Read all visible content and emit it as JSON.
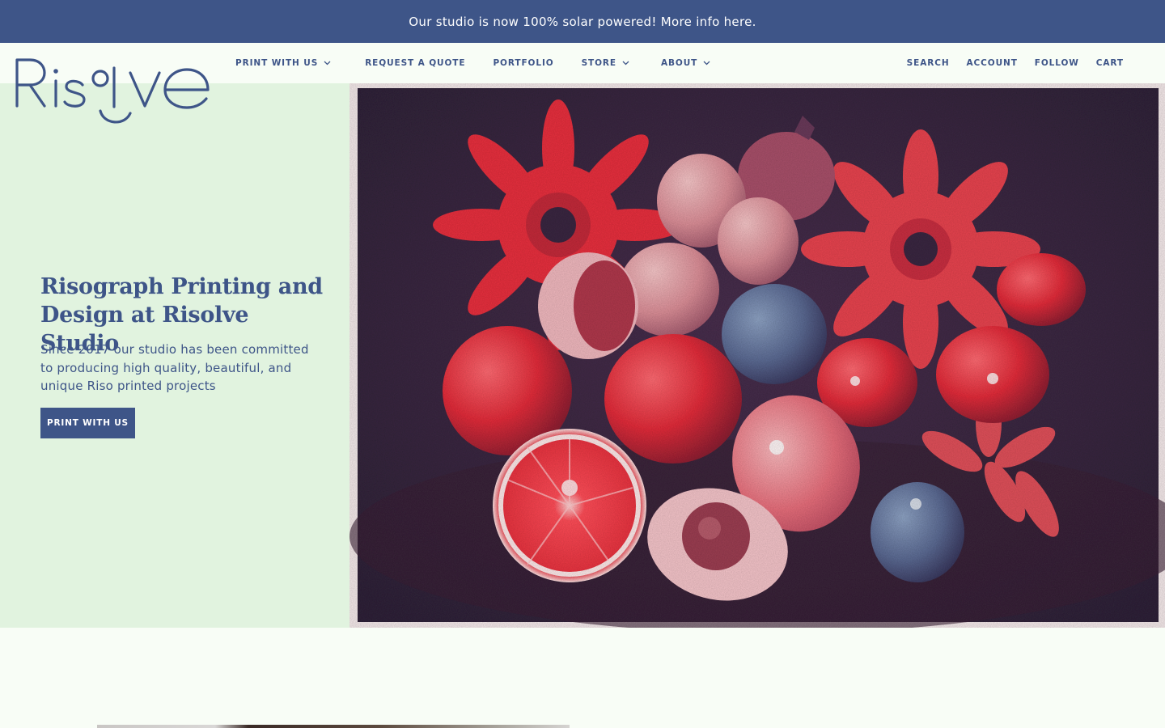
{
  "announcement": {
    "text": "Our studio is now 100% solar powered! More info here."
  },
  "brand": {
    "logo_text": "Risolve"
  },
  "nav": {
    "main": [
      {
        "label": "PRINT WITH US",
        "has_dropdown": true
      },
      {
        "label": "REQUEST A QUOTE",
        "has_dropdown": false
      },
      {
        "label": "PORTFOLIO",
        "has_dropdown": false
      },
      {
        "label": "STORE",
        "has_dropdown": true
      },
      {
        "label": "ABOUT",
        "has_dropdown": true
      }
    ],
    "utility": [
      {
        "label": "SEARCH"
      },
      {
        "label": "ACCOUNT"
      },
      {
        "label": "FOLLOW"
      },
      {
        "label": "CART"
      }
    ]
  },
  "hero": {
    "title": "Risograph Printing and Design at Risolve Studio",
    "subtitle": "Since 2017 our studio has been committed to producing high quality, beautiful, and unique Riso printed projects",
    "cta_label": "PRINT WITH US",
    "image_icon": "riso-still-life-flowers-fruit-image"
  },
  "colors": {
    "brand_blue": "#3e5588",
    "mint": "#e1f3df",
    "page_bg": "#f8fdf6",
    "riso_red": "#e8303e",
    "riso_dark": "#3a2741"
  }
}
